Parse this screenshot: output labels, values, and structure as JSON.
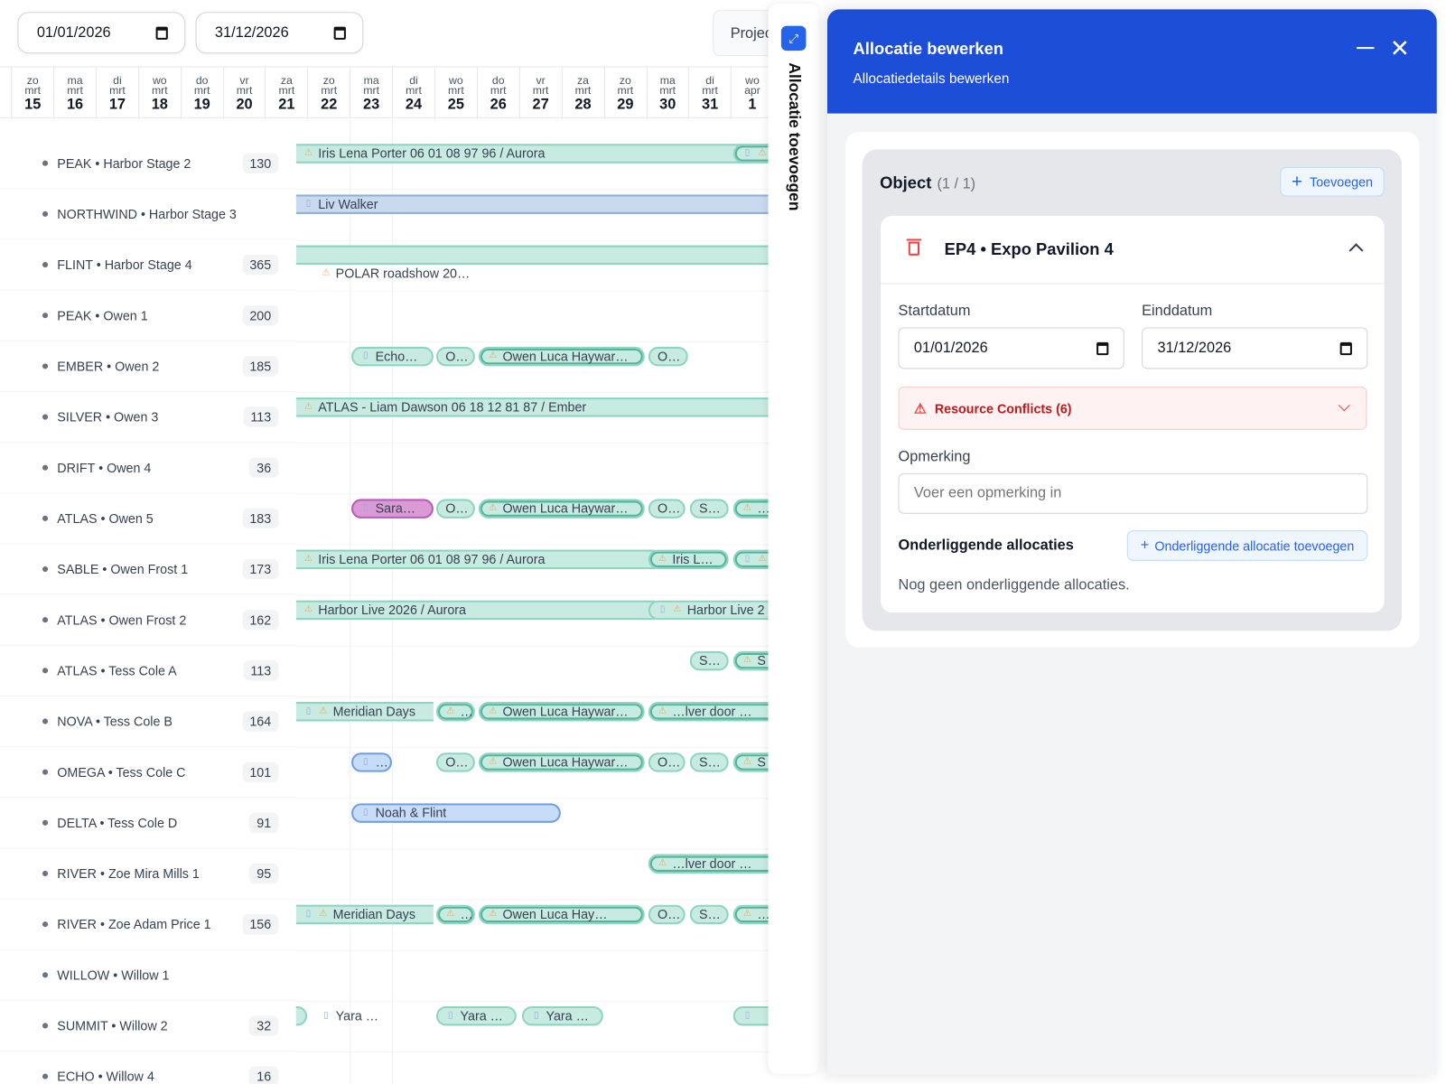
{
  "filters": {
    "start_date": "01/01/2026",
    "end_date": "31/12/2026",
    "project_button": "Projec"
  },
  "timeline": {
    "days": [
      {
        "dow": "zo",
        "month": "mrt",
        "day": "15"
      },
      {
        "dow": "ma",
        "month": "mrt",
        "day": "16"
      },
      {
        "dow": "di",
        "month": "mrt",
        "day": "17"
      },
      {
        "dow": "wo",
        "month": "mrt",
        "day": "18"
      },
      {
        "dow": "do",
        "month": "mrt",
        "day": "19"
      },
      {
        "dow": "vr",
        "month": "mrt",
        "day": "20"
      },
      {
        "dow": "za",
        "month": "mrt",
        "day": "21"
      },
      {
        "dow": "zo",
        "month": "mrt",
        "day": "22"
      },
      {
        "dow": "ma",
        "month": "mrt",
        "day": "23"
      },
      {
        "dow": "di",
        "month": "mrt",
        "day": "24"
      },
      {
        "dow": "wo",
        "month": "mrt",
        "day": "25"
      },
      {
        "dow": "do",
        "month": "mrt",
        "day": "26"
      },
      {
        "dow": "vr",
        "month": "mrt",
        "day": "27"
      },
      {
        "dow": "za",
        "month": "mrt",
        "day": "28"
      },
      {
        "dow": "zo",
        "month": "mrt",
        "day": "29"
      },
      {
        "dow": "ma",
        "month": "mrt",
        "day": "30"
      },
      {
        "dow": "di",
        "month": "mrt",
        "day": "31"
      },
      {
        "dow": "wo",
        "month": "apr",
        "day": "1"
      }
    ],
    "resources": [
      {
        "label": "PEAK • Harbor Stage 2",
        "count": "130"
      },
      {
        "label": "NORTHWIND • Harbor Stage 3",
        "count": ""
      },
      {
        "label": "FLINT • Harbor Stage 4",
        "count": "365"
      },
      {
        "label": "PEAK • Owen 1",
        "count": "200"
      },
      {
        "label": "EMBER • Owen 2",
        "count": "185"
      },
      {
        "label": "SILVER • Owen 3",
        "count": "113"
      },
      {
        "label": "DRIFT • Owen 4",
        "count": "36"
      },
      {
        "label": "ATLAS • Owen 5",
        "count": "183"
      },
      {
        "label": "SABLE • Owen Frost 1",
        "count": "173"
      },
      {
        "label": "ATLAS • Owen Frost 2",
        "count": "162"
      },
      {
        "label": "ATLAS • Tess Cole A",
        "count": "113"
      },
      {
        "label": "NOVA • Tess Cole B",
        "count": "164"
      },
      {
        "label": "OMEGA • Tess Cole C",
        "count": "101"
      },
      {
        "label": "DELTA • Tess Cole D",
        "count": "91"
      },
      {
        "label": "RIVER • Zoe Mira Mills 1",
        "count": "95"
      },
      {
        "label": "RIVER • Zoe Adam Price 1",
        "count": "156"
      },
      {
        "label": "WILLOW • Willow 1",
        "count": ""
      },
      {
        "label": "SUMMIT • Willow 2",
        "count": "32"
      },
      {
        "label": "ECHO • Willow 4",
        "count": "16"
      }
    ],
    "bars": [
      {
        "label": "Iris Lena Porter 06 01 08 97 96 / Aurora",
        "icons": [
          "warning"
        ]
      },
      {
        "label": "",
        "icons": [
          "document",
          "warning"
        ]
      },
      {
        "label": "Liv Walker",
        "icons": [
          "document"
        ]
      },
      {
        "label": "",
        "icons": []
      },
      {
        "label": "POLAR roadshow 20…",
        "icons": [
          "warning"
        ]
      },
      {
        "label": "Echo…",
        "icons": [
          "document"
        ]
      },
      {
        "label": "O…",
        "icons": []
      },
      {
        "label": "Owen Luca Haywar…",
        "icons": [
          "warning"
        ]
      },
      {
        "label": "O…",
        "icons": []
      },
      {
        "label": "ATLAS - Liam Dawson 06 18 12 81 87 / Ember",
        "icons": [
          "warning"
        ]
      },
      {
        "label": "Sara…",
        "icons": [
          "document"
        ]
      },
      {
        "label": "O…",
        "icons": []
      },
      {
        "label": "Owen Luca Haywar…",
        "icons": [
          "warning"
        ]
      },
      {
        "label": "O…",
        "icons": []
      },
      {
        "label": "S…",
        "icons": []
      },
      {
        "label": "…",
        "icons": [
          "warning"
        ]
      },
      {
        "label": "Iris Lena Porter 06 01 08 97 96 / Aurora",
        "icons": [
          "warning"
        ]
      },
      {
        "label": "Iris L…",
        "icons": [
          "warning"
        ]
      },
      {
        "label": "",
        "icons": [
          "document",
          "warning"
        ]
      },
      {
        "label": "Harbor Live 2026 / Aurora",
        "icons": [
          "warning"
        ]
      },
      {
        "label": "Harbor Live 2",
        "icons": [
          "document",
          "warning"
        ]
      },
      {
        "label": "S…",
        "icons": []
      },
      {
        "label": "S",
        "icons": [
          "warning"
        ]
      },
      {
        "label": "Meridian Days",
        "icons": [
          "document",
          "warning"
        ]
      },
      {
        "label": "…",
        "icons": [
          "warning"
        ]
      },
      {
        "label": "Owen Luca Haywar…",
        "icons": [
          "warning"
        ]
      },
      {
        "label": "…lver door …",
        "icons": [
          "warning"
        ]
      },
      {
        "label": "…",
        "icons": [
          "document"
        ]
      },
      {
        "label": "O…",
        "icons": []
      },
      {
        "label": "Owen Luca Haywar…",
        "icons": [
          "warning"
        ]
      },
      {
        "label": "O…",
        "icons": []
      },
      {
        "label": "S…",
        "icons": []
      },
      {
        "label": "S",
        "icons": [
          "warning"
        ]
      },
      {
        "label": "Noah & Flint",
        "icons": [
          "document"
        ]
      },
      {
        "label": "…lver door …",
        "icons": [
          "warning"
        ]
      },
      {
        "label": "Meridian Days",
        "icons": [
          "document",
          "warning"
        ]
      },
      {
        "label": "…",
        "icons": [
          "warning"
        ]
      },
      {
        "label": "Owen Luca Hay…",
        "icons": [
          "warning"
        ]
      },
      {
        "label": "O…",
        "icons": []
      },
      {
        "label": "S…",
        "icons": []
      },
      {
        "label": "…",
        "icons": [
          "warning"
        ]
      },
      {
        "label": "",
        "icons": []
      },
      {
        "label": "Yara …",
        "icons": [
          "document"
        ]
      },
      {
        "label": "Yara …",
        "icons": [
          "document"
        ]
      },
      {
        "label": "Yara …",
        "icons": [
          "document"
        ]
      },
      {
        "label": "",
        "icons": [
          "document"
        ]
      }
    ]
  },
  "side_tab": {
    "label": "Allocatie toevoegen",
    "icon": "expand-icon"
  },
  "panel": {
    "title": "Allocatie bewerken",
    "subtitle": "Allocatiedetails bewerken",
    "header_color": "#1d4ed8",
    "object_section": {
      "title": "Object",
      "count": "(1 / 1)",
      "add_button": "Toevoegen",
      "item": {
        "name": "EP4 • Expo Pavilion 4",
        "start_label": "Startdatum",
        "start_value": "01/01/2026",
        "end_label": "Einddatum",
        "end_value": "31/12/2026",
        "conflicts": "Resource Conflicts (6)",
        "remark_label": "Opmerking",
        "remark_placeholder": "Voer een opmerking in",
        "remark_value": "",
        "sub_title": "Onderliggende allocaties",
        "sub_add_button": "Onderliggende allocatie toevoegen",
        "sub_empty": "Nog geen onderliggende allocaties."
      }
    }
  },
  "colors": {
    "accent": "#2563eb",
    "allocation": "#c8ebe1",
    "conflict": "#b91c1c"
  }
}
